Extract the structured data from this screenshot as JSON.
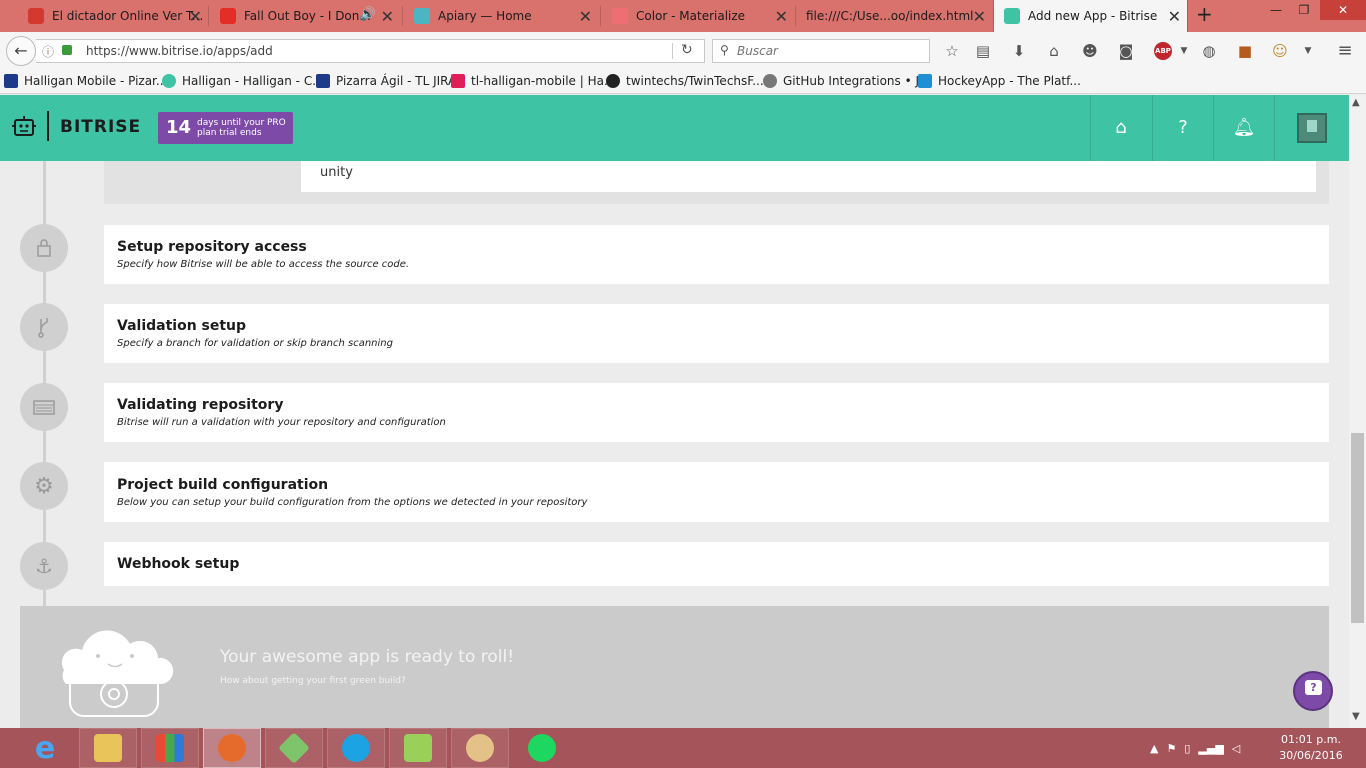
{
  "browser": {
    "tabs": [
      {
        "title": "El dictador Online Ver T...",
        "icon_color": "#d23a2f"
      },
      {
        "title": "Fall Out Boy - I Don...",
        "icon_color": "#e52d27"
      },
      {
        "title": "Apiary — Home",
        "icon_color": "#4bb5c1"
      },
      {
        "title": "Color - Materialize",
        "icon_color": "#ee6e73"
      },
      {
        "title": "file:///C:/Use...oo/index.html",
        "icon_color": "#888888"
      },
      {
        "title": "Add new App - Bitrise",
        "icon_color": "#3ec4a5"
      }
    ],
    "url": "https://www.bitrise.io/apps/add",
    "search_placeholder": "Buscar",
    "bookmarks": [
      {
        "label": "Halligan Mobile - Pizar...",
        "icon_color": "#1e3a8a"
      },
      {
        "label": "Halligan - Halligan - C...",
        "icon_color": "#3ec4a5"
      },
      {
        "label": "Pizarra Ágil - TL JIRA",
        "icon_color": "#1e3a8a"
      },
      {
        "label": "tl-halligan-mobile | Ha...",
        "icon_color": "#e01e5a"
      },
      {
        "label": "twintechs/TwinTechsF...",
        "icon_color": "#222222"
      },
      {
        "label": "GitHub Integrations • J...",
        "icon_color": "#777777"
      },
      {
        "label": "HockeyApp - The Platf...",
        "icon_color": "#1f8fd5"
      }
    ]
  },
  "app": {
    "logo": "BITRISE",
    "trial": {
      "days": "14",
      "text": "days until your PRO plan trial ends"
    },
    "colors": {
      "header": "#3ec4a5",
      "trial_badge": "#7d4aa8"
    }
  },
  "previous_step_value": "unity",
  "steps": [
    {
      "title": "Setup repository access",
      "description": "Specify how Bitrise will be able to access the source code.",
      "icon": "lock-icon"
    },
    {
      "title": "Validation setup",
      "description": "Specify a branch for validation or skip branch scanning",
      "icon": "branch-icon"
    },
    {
      "title": "Validating repository",
      "description": "Bitrise will run a validation with your repository and configuration",
      "icon": "server-icon"
    },
    {
      "title": "Project build configuration",
      "description": "Below you can setup your build configuration from the options we detected in your repository",
      "icon": "gear-icon"
    },
    {
      "title": "Webhook setup",
      "description": "",
      "icon": "anchor-icon"
    }
  ],
  "ready": {
    "title": "Your awesome app is ready to roll!",
    "subtitle": "How about getting your first green build?"
  },
  "taskbar": {
    "time": "01:01 p.m.",
    "date": "30/06/2016"
  }
}
